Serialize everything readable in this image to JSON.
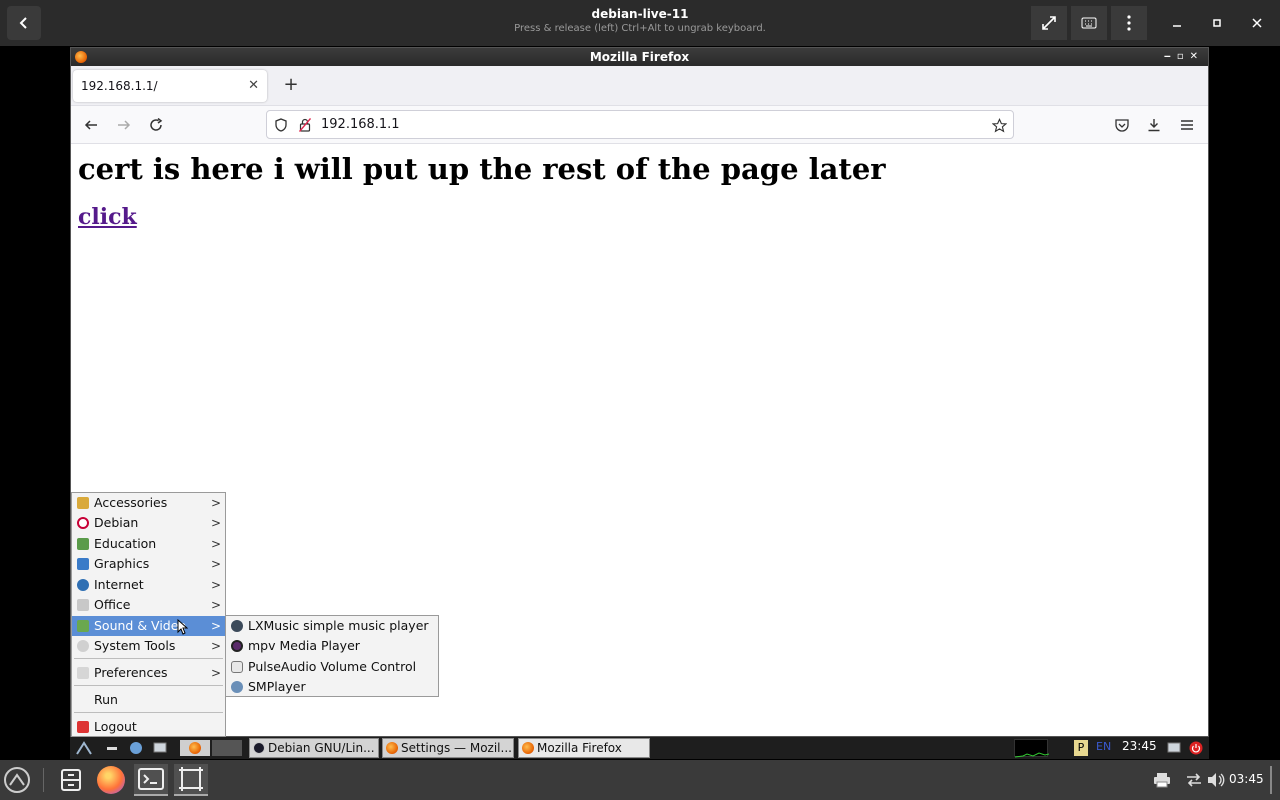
{
  "session": {
    "title": "debian-live-11",
    "subtitle": "Press & release (left) Ctrl+Alt to ungrab keyboard."
  },
  "firefox": {
    "window_title": "Mozilla Firefox",
    "tab_title": "192.168.1.1/",
    "url": "192.168.1.1"
  },
  "page": {
    "heading": "cert is here i will put up the rest of the page later",
    "link_text": "click"
  },
  "menu": {
    "items": [
      {
        "label": "Accessories",
        "icon": "accessories-icon",
        "color": "#d9a93a"
      },
      {
        "label": "Debian",
        "icon": "debian-icon",
        "color": "#c70036"
      },
      {
        "label": "Education",
        "icon": "education-icon",
        "color": "#5a9b4a"
      },
      {
        "label": "Graphics",
        "icon": "graphics-icon",
        "color": "#3a7bc8"
      },
      {
        "label": "Internet",
        "icon": "internet-icon",
        "color": "#2f6fb3"
      },
      {
        "label": "Office",
        "icon": "office-icon",
        "color": "#a0a0a0"
      },
      {
        "label": "Sound & Video",
        "icon": "sound-video-icon",
        "color": "#6aa84f"
      },
      {
        "label": "System Tools",
        "icon": "system-tools-icon",
        "color": "#888888"
      },
      {
        "label": "Preferences",
        "icon": "preferences-icon",
        "color": "#b0b0b0"
      },
      {
        "label": "Run",
        "icon": "",
        "color": ""
      },
      {
        "label": "Logout",
        "icon": "logout-icon",
        "color": "#d33"
      }
    ],
    "sound_video_submenu": [
      {
        "label": "LXMusic simple music player",
        "icon": "lxmusic-icon"
      },
      {
        "label": "mpv Media Player",
        "icon": "mpv-icon"
      },
      {
        "label": "PulseAudio Volume Control",
        "icon": "pulseaudio-icon"
      },
      {
        "label": "SMPlayer",
        "icon": "smplayer-icon"
      }
    ]
  },
  "lx_panel": {
    "tasks": [
      {
        "label": "Debian GNU/Lin...",
        "icon": "terminal-icon"
      },
      {
        "label": "Settings — Mozil...",
        "icon": "firefox-icon"
      },
      {
        "label": "Mozilla Firefox",
        "icon": "firefox-icon"
      }
    ],
    "keyboard_layout": "EN",
    "clock": "23:45"
  },
  "host": {
    "clock": "03:45"
  },
  "colors": {
    "menu_highlight": "#5b8ed6",
    "link_visited": "#551a8b"
  }
}
